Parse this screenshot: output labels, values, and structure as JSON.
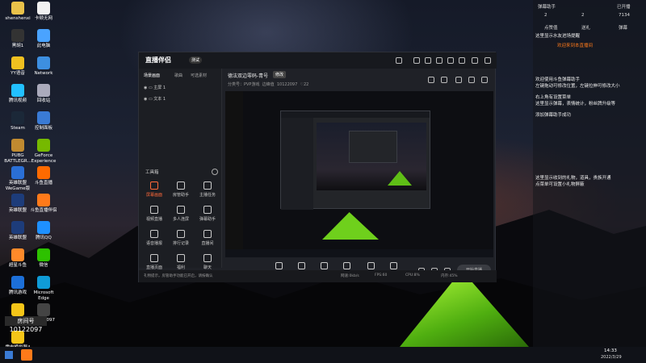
{
  "desktop_icons": [
    {
      "label": "shenshenxi",
      "color": "#e9c24a"
    },
    {
      "label": "卡顿无网",
      "color": "#f1f1f1"
    },
    {
      "label": "黑胡1",
      "color": "#333"
    },
    {
      "label": "此电脑",
      "color": "#4aa3ff"
    },
    {
      "label": "YY语音",
      "color": "#f0c020"
    },
    {
      "label": "Network",
      "color": "#3d8fe0"
    },
    {
      "label": "腾讯视频",
      "color": "#22c0ff"
    },
    {
      "label": "回收站",
      "color": "#aab"
    },
    {
      "label": "Steam",
      "color": "#1b2838"
    },
    {
      "label": "控制面板",
      "color": "#3a7bd5"
    },
    {
      "label": "PUBG BATTLEGR...",
      "color": "#c08a30"
    },
    {
      "label": "GeForce Experience",
      "color": "#76b900"
    },
    {
      "label": "英雄联盟 WeGame版",
      "color": "#2a6fd6"
    },
    {
      "label": "斗鱼直播",
      "color": "#ff6a00"
    },
    {
      "label": "英雄联盟",
      "color": "#1d3c7a"
    },
    {
      "label": "斗鱼直播伴侣",
      "color": "#ff7a1a"
    },
    {
      "label": "英雄联盟",
      "color": "#1d3c7a"
    },
    {
      "label": "腾讯QQ",
      "color": "#1e90ff"
    },
    {
      "label": "超星斗鱼",
      "color": "#ff8a2a"
    },
    {
      "label": "微信",
      "color": "#2dc100"
    },
    {
      "label": "腾讯游戏",
      "color": "#1c6fd8"
    },
    {
      "label": "Microsoft Edge",
      "color": "#0f9bd7"
    },
    {
      "label": "雷电多开器4",
      "color": "#f5c518"
    },
    {
      "label": "10122097",
      "color": "#444"
    },
    {
      "label": "雷电模拟器4",
      "color": "#f5c518"
    }
  ],
  "badge": {
    "text": "10122097",
    "sub": "房间号"
  },
  "app": {
    "logo": "直播伴侣",
    "version": "测试",
    "side_tabs": [
      "场景画面",
      "歌曲",
      "可选素材"
    ],
    "sources": [
      "主屏 1",
      "文本 1"
    ],
    "tools_title": "工具箱",
    "tools": [
      "屏幕画面",
      "房管助手",
      "主播任务",
      "视频直播",
      "多人连屏",
      "弹幕助手",
      "语音播报",
      "排行记录",
      "直播间",
      "直播页面",
      "福利",
      "聊天"
    ],
    "room_title": "德法双边零码-青号",
    "room_tag": "修改",
    "room_meta": [
      "分类号：PVP游戏",
      "边峰值",
      "10122097",
      "22"
    ],
    "bottom_buttons": [
      "直播屏幕",
      "摄像头",
      "手机投屏",
      "多媒体",
      "麦克风",
      "扬声器"
    ],
    "start_button": "开始直播",
    "status_hint": "礼物提示，房管助手功能已开启，请按确认",
    "status_items": [
      "网速:0kb/s",
      "FPS:60",
      "CPU:8%",
      "内存:45%"
    ]
  },
  "dock": {
    "header": [
      "弹幕助手",
      "已开播"
    ],
    "stats": [
      "2",
      "2",
      "7134"
    ],
    "tabs": [
      "点赞值",
      "送礼",
      "弹幕"
    ],
    "lines": [
      "这里显示水友进场提醒",
      "欢迎来到本直播间",
      "欢迎使用斗鱼弹幕助手",
      "左键拖动可修改位置，左键拉伸可修改大小",
      "右上角有设置菜单",
      "这里显示弹幕，表情统计，粉丝牌升级等",
      "添加弹幕助手成功",
      "这里显示收到的礼物，道具，贵族开通",
      "点菜单可设置小礼物屏蔽"
    ]
  },
  "clock": {
    "time": "14:33",
    "date": "2022/3/29"
  }
}
